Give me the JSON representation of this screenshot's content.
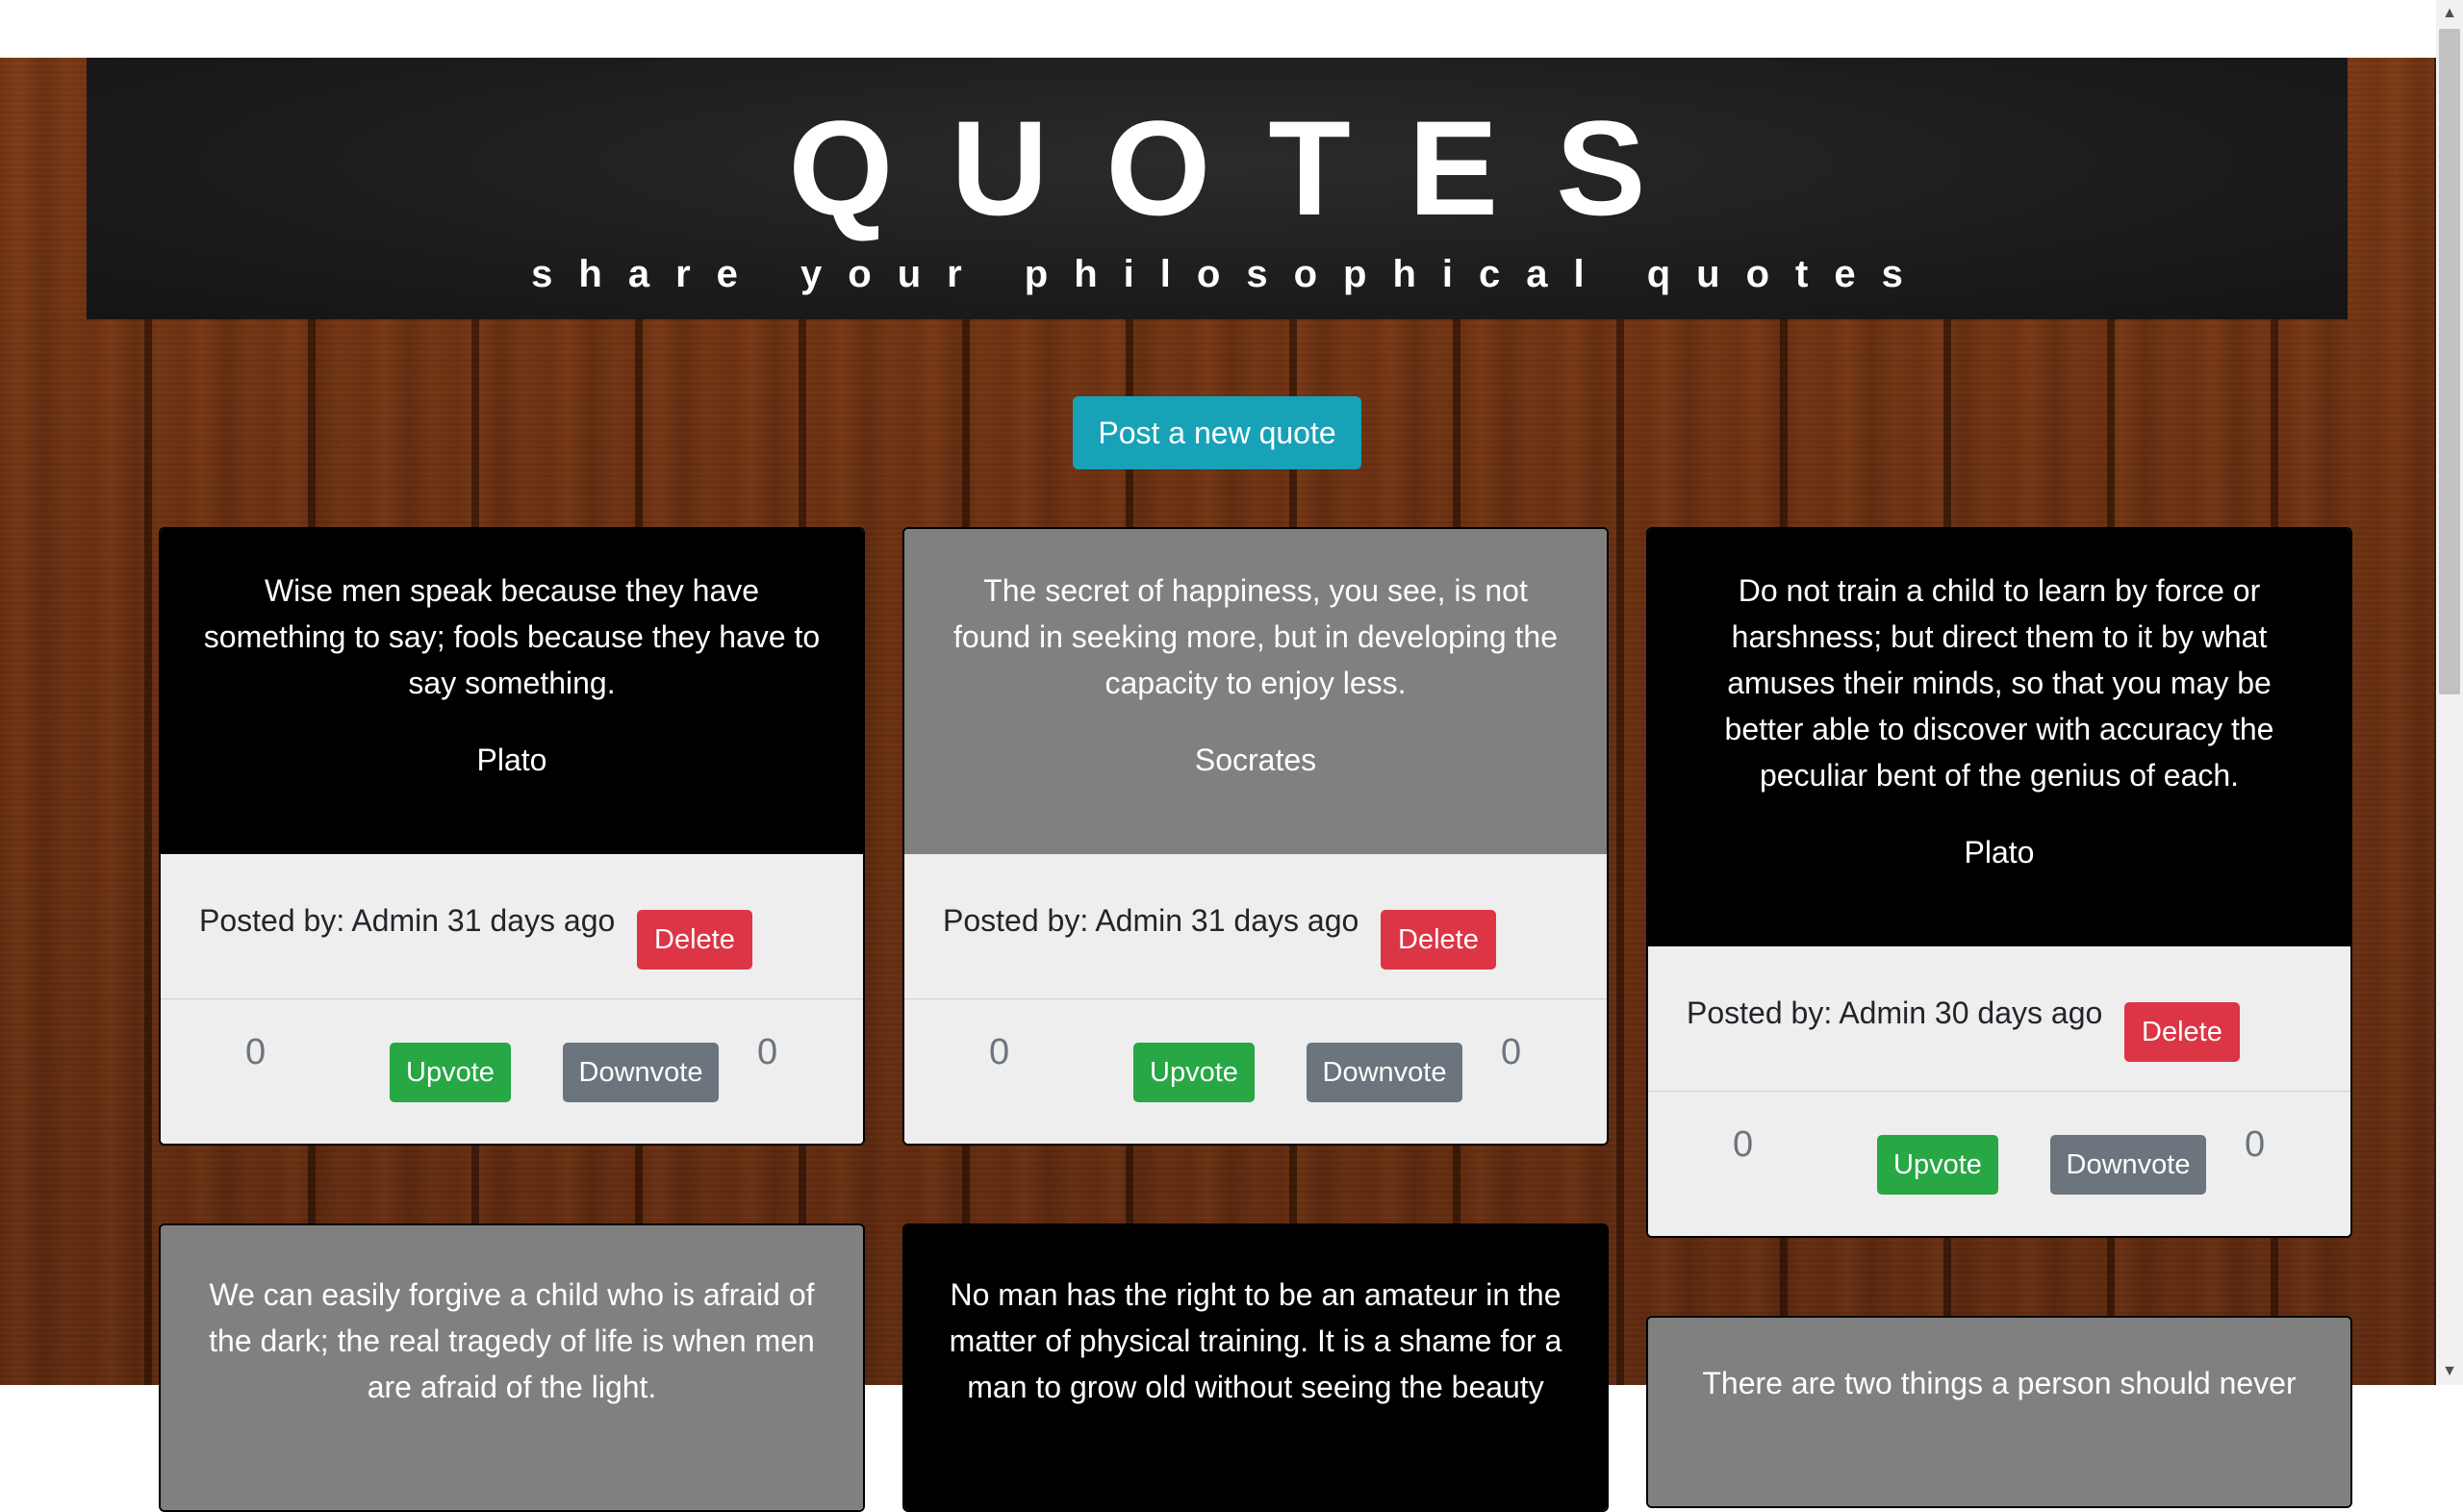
{
  "header": {
    "title": "QUOTES",
    "subtitle": "share your philosophical quotes"
  },
  "actions": {
    "post_label": "Post a new quote"
  },
  "quotes": [
    {
      "text": "Wise men speak because they have something to say; fools because they have to say something.",
      "author": "Plato",
      "posted": "Posted by: Admin 31 days ago",
      "delete_label": "Delete",
      "upvotes": "0",
      "downvotes": "0",
      "upvote_label": "Upvote",
      "downvote_label": "Downvote",
      "theme": "dark"
    },
    {
      "text": "The secret of happiness, you see, is not found in seeking more, but in developing the capacity to enjoy less.",
      "author": "Socrates",
      "posted": "Posted by: Admin 31 days ago",
      "delete_label": "Delete",
      "upvotes": "0",
      "downvotes": "0",
      "upvote_label": "Upvote",
      "downvote_label": "Downvote",
      "theme": "gray"
    },
    {
      "text": "Do not train a child to learn by force or harshness; but direct them to it by what amuses their minds, so that you may be better able to discover with accuracy the peculiar bent of the genius of each.",
      "author": "Plato",
      "posted": "Posted by: Admin 30 days ago",
      "delete_label": "Delete",
      "upvotes": "0",
      "downvotes": "0",
      "upvote_label": "Upvote",
      "downvote_label": "Downvote",
      "theme": "dark"
    },
    {
      "text": "We can easily forgive a child who is afraid of the dark; the real tragedy of life is when men are afraid of the light.",
      "theme": "gray"
    },
    {
      "text": "No man has the right to be an amateur in the matter of physical training. It is a shame for a man to grow old without seeing the beauty",
      "theme": "dark"
    },
    {
      "text": "There are two things a person should never",
      "theme": "gray"
    }
  ],
  "colors": {
    "post_button": "#17a2b8",
    "delete_button": "#dc3545",
    "upvote_button": "#28a745",
    "downvote_button": "#6c757d"
  }
}
